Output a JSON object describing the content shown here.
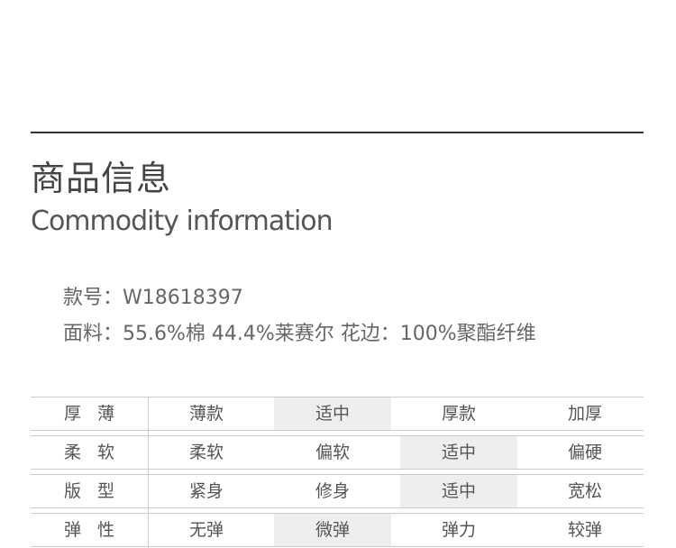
{
  "header": {
    "title_cn": "商品信息",
    "title_en": "Commodity information"
  },
  "info": {
    "style_no": "款号：W18618397",
    "fabric": "面料：55.6%棉 44.4%莱赛尔 花边：100%聚酯纤维"
  },
  "specs": [
    {
      "label": "厚薄",
      "options": [
        "薄款",
        "适中",
        "厚款",
        "加厚"
      ],
      "selected": 1
    },
    {
      "label": "柔软",
      "options": [
        "柔软",
        "偏软",
        "适中",
        "偏硬"
      ],
      "selected": 2
    },
    {
      "label": "版型",
      "options": [
        "紧身",
        "修身",
        "适中",
        "宽松"
      ],
      "selected": 2
    },
    {
      "label": "弹性",
      "options": [
        "无弹",
        "微弹",
        "弹力",
        "较弹"
      ],
      "selected": 1
    }
  ]
}
